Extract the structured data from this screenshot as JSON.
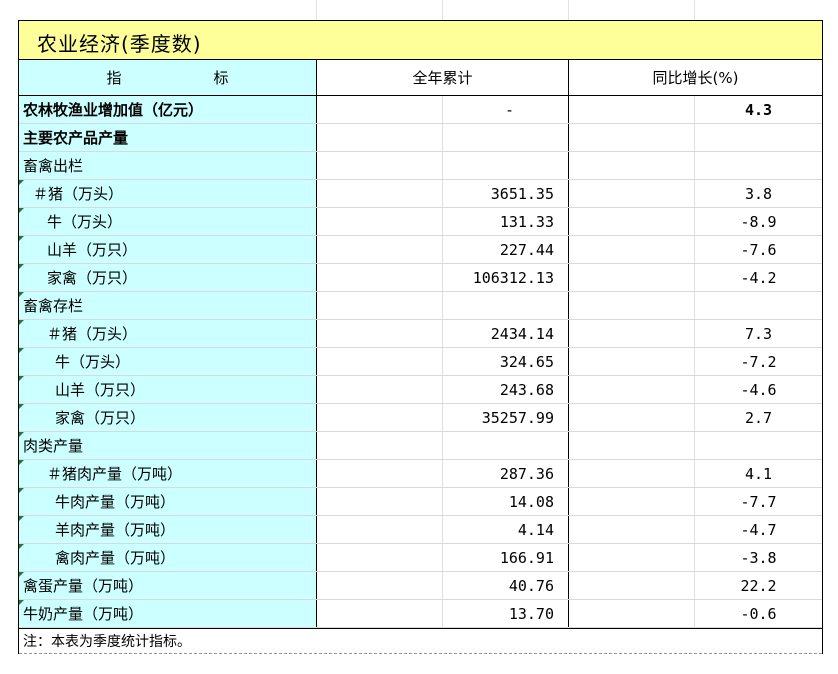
{
  "title": "农业经济(季度数)",
  "header": {
    "label_a": "指",
    "label_b": "标",
    "cumulative": "全年累计",
    "yoy": "同比增长(%)"
  },
  "rows": [
    {
      "label": "农林牧渔业增加值（亿元）",
      "cum": "-",
      "yoy": "4.3",
      "style": "bold",
      "indent": 0
    },
    {
      "label": "主要农产品产量",
      "cum": "",
      "yoy": "",
      "style": "bold",
      "indent": 0
    },
    {
      "label": "畜禽出栏",
      "cum": "",
      "yoy": "",
      "style": "normal",
      "indent": 0
    },
    {
      "label": "＃猪（万头）",
      "cum": "3651.35",
      "yoy": "3.8",
      "style": "normal",
      "indent": 1
    },
    {
      "label": "牛（万头）",
      "cum": "131.33",
      "yoy": "-8.9",
      "style": "normal",
      "indent": 2
    },
    {
      "label": "山羊（万只）",
      "cum": "227.44",
      "yoy": "-7.6",
      "style": "normal",
      "indent": 2
    },
    {
      "label": "家禽（万只）",
      "cum": "106312.13",
      "yoy": "-4.2",
      "style": "normal",
      "indent": 2
    },
    {
      "label": "畜禽存栏",
      "cum": "",
      "yoy": "",
      "style": "normal",
      "indent": 0
    },
    {
      "label": "＃猪（万头）",
      "cum": "2434.14",
      "yoy": "7.3",
      "style": "normal",
      "indent": 2
    },
    {
      "label": "牛（万头）",
      "cum": "324.65",
      "yoy": "-7.2",
      "style": "normal",
      "indent": 3
    },
    {
      "label": "山羊（万只）",
      "cum": "243.68",
      "yoy": "-4.6",
      "style": "normal",
      "indent": 3
    },
    {
      "label": "家禽（万只）",
      "cum": "35257.99",
      "yoy": "2.7",
      "style": "normal",
      "indent": 3
    },
    {
      "label": "肉类产量",
      "cum": "",
      "yoy": "",
      "style": "normal",
      "indent": 0
    },
    {
      "label": "＃猪肉产量（万吨）",
      "cum": "287.36",
      "yoy": "4.1",
      "style": "normal",
      "indent": 2
    },
    {
      "label": "牛肉产量（万吨）",
      "cum": "14.08",
      "yoy": "-7.7",
      "style": "normal",
      "indent": 3
    },
    {
      "label": "羊肉产量（万吨）",
      "cum": "4.14",
      "yoy": "-4.7",
      "style": "normal",
      "indent": 3
    },
    {
      "label": "禽肉产量（万吨）",
      "cum": "166.91",
      "yoy": "-3.8",
      "style": "normal",
      "indent": 3
    },
    {
      "label": "禽蛋产量（万吨）",
      "cum": "40.76",
      "yoy": "22.2",
      "style": "normal",
      "indent": 0
    },
    {
      "label": "牛奶产量（万吨）",
      "cum": "13.70",
      "yoy": "-0.6",
      "style": "normal",
      "indent": 0
    }
  ],
  "note": "注：本表为季度统计指标。",
  "colors": {
    "title_bg": "#ffff99",
    "label_bg": "#ccffff"
  }
}
